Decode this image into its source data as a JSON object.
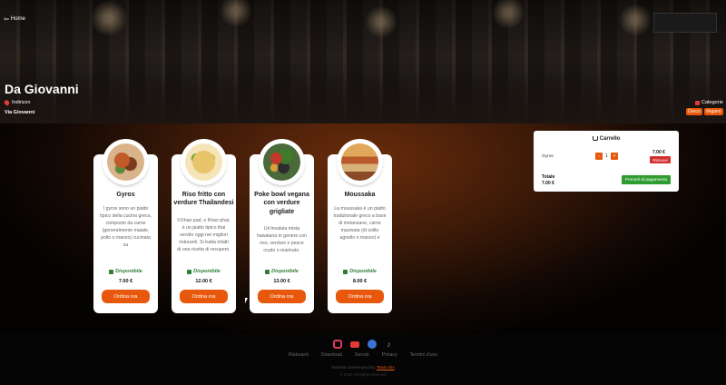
{
  "header": {
    "home_label": "Home",
    "title": "Da Giovanni",
    "address_label": "Indirizzo",
    "address_value": "Via Giovanni",
    "categories_label": "Categorie",
    "categories": [
      "Greco",
      "Vegano"
    ]
  },
  "menu": {
    "items": [
      {
        "name": "Gyros",
        "description": "I gyros sono un piatto tipico della cucina greca, composto da carne (generalmente maiale, pollo o manzo) cucinata su",
        "availability": "Disponibile",
        "price": "7.00 €",
        "order_label": "Ordina ora"
      },
      {
        "name": "Riso fritto con verdure Thailandesi",
        "description": "Il Khao pad, o Khao phat, è un piatto tipico thai servito oggi nei migliori ristoranti. Si tratta infatti di una ricetta di recupero,",
        "availability": "Disponibile",
        "price": "12.00 €",
        "order_label": "Ordina ora"
      },
      {
        "name": "Poke bowl vegana con verdure grigliate",
        "description": "Un'insalata mista hawaiana in genere con riso, verdure e pesce crudo o marinato.",
        "availability": "Disponibile",
        "price": "13.00 €",
        "order_label": "Ordina ora"
      },
      {
        "name": "Moussaka",
        "description": "La moussaka è un piatto tradizionale greco a base di melanzane, carne macinata (di solito agnello o manzo) e",
        "availability": "Disponibile",
        "price": "8.00 €",
        "order_label": "Ordina ora"
      }
    ]
  },
  "cart": {
    "title": "Carrello",
    "item_name": "Gyros",
    "quantity": "1",
    "minus_label": "-",
    "plus_label": "+",
    "item_price": "7.00 €",
    "remove_label": "Rimuovi",
    "total_label": "Totale",
    "total_value": "7.00 €",
    "checkout_label": "Procedi al pagamento"
  },
  "footer": {
    "social_icons": [
      "instagram-icon",
      "youtube-icon",
      "telegram-icon",
      "tiktok-icon"
    ],
    "links": [
      "Ristoranti",
      "Download",
      "Servizi",
      "Privacy",
      "Termini d'uso"
    ],
    "credit_prefix": "Website Developed By",
    "credit_team": "Team Six",
    "copyright": "© 2024 All rights reserved"
  },
  "colors": {
    "accent": "#e8580c",
    "available": "#2e7d32",
    "checkout": "#2e9c2e",
    "remove": "#d32f2f"
  }
}
